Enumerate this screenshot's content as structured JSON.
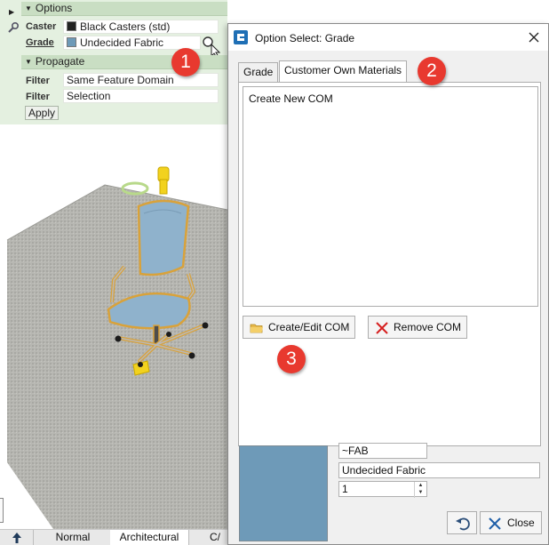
{
  "options_panel": {
    "options_header": "Options",
    "caster_label": "Caster",
    "caster_value": "Black Casters (std)",
    "caster_swatch": "#222222",
    "grade_label": "Grade",
    "grade_value": "Undecided Fabric",
    "grade_swatch": "#6e9ab8",
    "propagate_header": "Propagate",
    "filter1_label": "Filter",
    "filter1_value": "Same Feature Domain",
    "filter2_label": "Filter",
    "filter2_value": "Selection",
    "apply_label": "Apply"
  },
  "bottom_tabs": {
    "arrow_icon": "up-arrow-icon",
    "tab1": "Normal",
    "tab2": "Architectural",
    "tab3": "C/"
  },
  "dialog": {
    "title": "Option Select: Grade",
    "tabs": [
      "Grade",
      "Customer Own Materials"
    ],
    "active_tab": "Customer Own Materials",
    "list_items": [
      "Create New COM"
    ],
    "create_edit_label": "Create/Edit COM",
    "remove_label": "Remove COM",
    "code_value": "~FAB",
    "name_value": "Undecided Fabric",
    "quantity_value": "1",
    "close_label": "Close",
    "preview_color": "#6e9ab8"
  },
  "callouts": [
    "1",
    "2",
    "3"
  ],
  "colors": {
    "panel_green": "#e4f0e0",
    "callout_red": "#e8392f",
    "chair_blue": "#8fb2cc",
    "selection_orange": "#d9a23a"
  }
}
